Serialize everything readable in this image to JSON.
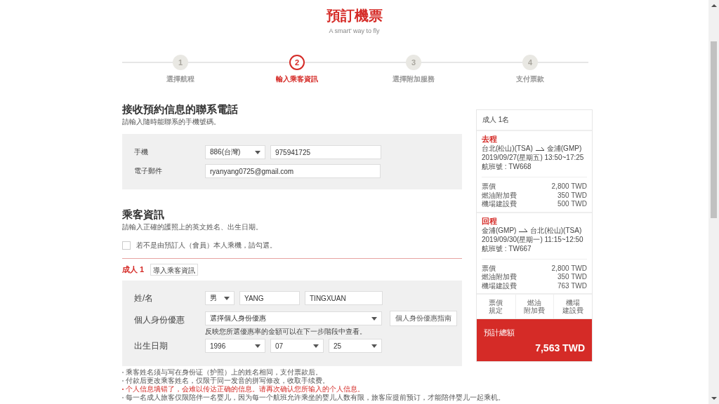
{
  "header": {
    "title": "預訂機票",
    "subtitle": "A smart' way to fly"
  },
  "steps": [
    {
      "number": "1",
      "label": "選擇航程",
      "selected": false
    },
    {
      "number": "2",
      "label": "輸入乘客資訊",
      "selected": true
    },
    {
      "number": "3",
      "label": "選擇附加服務",
      "selected": false
    },
    {
      "number": "4",
      "label": "支付票款",
      "selected": false
    }
  ],
  "contact": {
    "heading": "接收預約信息的聯系電話",
    "hint": "請輸入隨時能聯系的手機號碼。",
    "fields": [
      {
        "kind": "phone",
        "label": "手機",
        "country": "886(台灣)",
        "value": "975941725"
      },
      {
        "kind": "text",
        "label": "電子郵件",
        "value": "ryanyang0725@gmail.com"
      }
    ]
  },
  "passengers": {
    "heading": "乘客資訊",
    "hint": "請輸入正確的護照上的英文姓名、出生日期。",
    "not_self": {
      "label": "若不是由預訂人（會員）本人乘機，請勾選。",
      "checked": false
    },
    "passenger": {
      "title": "成人 1",
      "import_button": "導入乘客資訊",
      "name": {
        "label": "姓/名",
        "gender": "男",
        "last": "YANG",
        "first": "TINGXUAN"
      },
      "discount": {
        "label": "個人身份優惠",
        "value": "選擇個人身份優惠",
        "guide_button": "個人身份優惠指南",
        "note": "反映您所選優惠率的金額可以在下一步階段中查看。"
      },
      "birth": {
        "label": "出生日期",
        "year": "1996",
        "month": "07",
        "day": "25"
      }
    },
    "notes": [
      {
        "text": "乘客姓名须与写在身份证（护照）上的姓名相同，支付票款后。",
        "warning": false
      },
      {
        "text": "付款后更改乘客姓名，仅限于同一发音的拼写修改，收取手续费。",
        "warning": false
      },
      {
        "text": "个人信息填错了，会难以传达正确的信息。请再次确认您所输入的个人信息。",
        "warning": true
      },
      {
        "text": "每一名成人旅客仅限陪伴一名婴儿，因为每一个航班允许乘坐的婴儿人数有限，旅客应提前预订，才能陪伴婴儿一起乘机。",
        "warning": false
      }
    ]
  },
  "summary": {
    "passengers": "成人 1名",
    "legs": [
      {
        "title": "去程",
        "from": "台北(松山)(TSA)",
        "to": "金浦(GMP)",
        "time": "2019/09/27(星期五) 13:50~17:25",
        "flight": "航班號 : TW668",
        "fees": [
          {
            "label": "票價",
            "amount": "2,800 TWD"
          },
          {
            "label": "燃油附加費",
            "amount": "350 TWD"
          },
          {
            "label": "機場建設費",
            "amount": "500 TWD"
          }
        ]
      },
      {
        "title": "回程",
        "from": "金浦(GMP)",
        "to": "台北(松山)(TSA)",
        "time": "2019/09/30(星期一) 11:15~12:50",
        "flight": "航班號 : TW667",
        "fees": [
          {
            "label": "票價",
            "amount": "2,800 TWD"
          },
          {
            "label": "燃油附加費",
            "amount": "350 TWD"
          },
          {
            "label": "機場建設費",
            "amount": "763 TWD"
          }
        ]
      }
    ],
    "links": [
      [
        "票價",
        "規定"
      ],
      [
        "燃油",
        "附加費"
      ],
      [
        "機場",
        "建設費"
      ]
    ],
    "total_label": "預計總額",
    "total": "7,563 TWD"
  }
}
